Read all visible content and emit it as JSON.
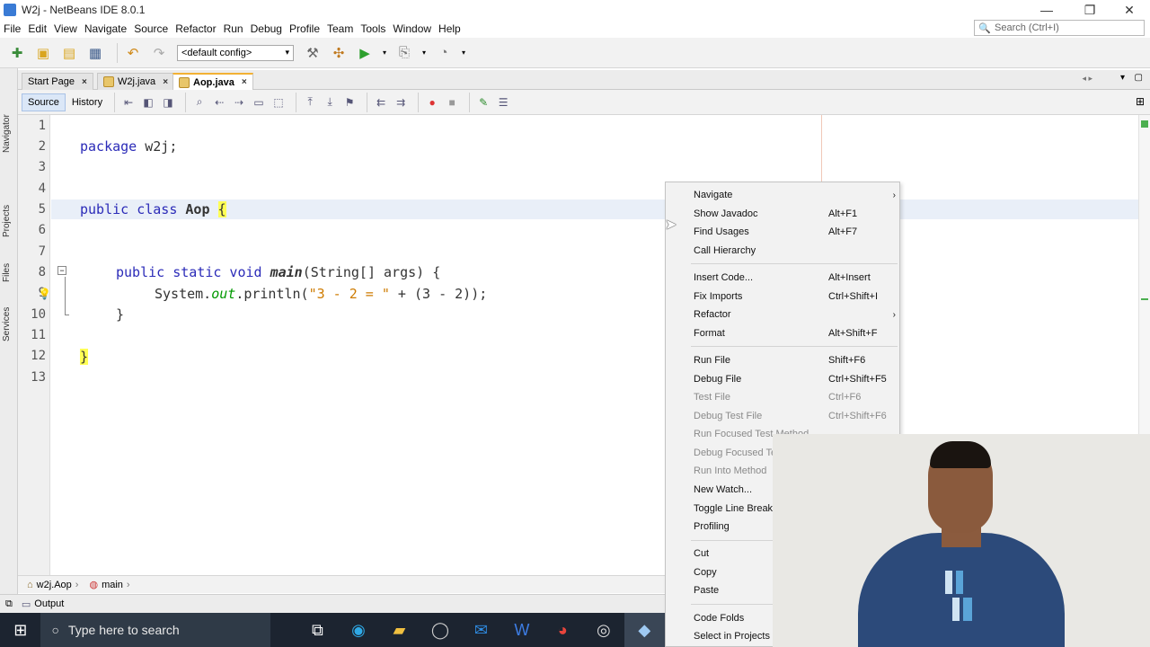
{
  "window": {
    "title": "W2j - NetBeans IDE 8.0.1",
    "minimize": "—",
    "maximize": "❐",
    "close": "✕"
  },
  "menubar": [
    "File",
    "Edit",
    "View",
    "Navigate",
    "Source",
    "Refactor",
    "Run",
    "Debug",
    "Profile",
    "Team",
    "Tools",
    "Window",
    "Help"
  ],
  "search": {
    "placeholder": "Search (Ctrl+I)"
  },
  "toolbar": {
    "config": "<default config>"
  },
  "side_panels": [
    "Navigator",
    "Projects",
    "Files",
    "Services"
  ],
  "tabs": [
    {
      "label": "Start Page",
      "active": false
    },
    {
      "label": "W2j.java",
      "active": false
    },
    {
      "label": "Aop.java",
      "active": true
    }
  ],
  "editor_tabs": {
    "source": "Source",
    "history": "History"
  },
  "code": {
    "line_numbers": [
      "1",
      "2",
      "3",
      "4",
      "5",
      "6",
      "7",
      "8",
      "9",
      "10",
      "11",
      "12",
      "13"
    ],
    "lines": {
      "l2_kw": "package",
      "l2_rest": " w2j;",
      "l5_kw": "public class",
      "l5_name": "Aop",
      "l5_brace": "{",
      "l8_kw": "public static void",
      "l8_method": "main",
      "l8_rest": "(String[] args) {",
      "l9_a": "System.",
      "l9_field": "out",
      "l9_b": ".println(",
      "l9_str": "\"3 - 2 = \"",
      "l9_c": " + (3 - 2));",
      "l10": "}",
      "l12": "}"
    }
  },
  "breadcrumb": [
    "w2j.Aop",
    "main"
  ],
  "output_label": "Output",
  "taskbar": {
    "search_placeholder": "Type here to search"
  },
  "context_menu": {
    "group1": [
      {
        "label": "Navigate",
        "shortcut": "",
        "submenu": true,
        "disabled": false
      },
      {
        "label": "Show Javadoc",
        "shortcut": "Alt+F1",
        "submenu": false,
        "disabled": false
      },
      {
        "label": "Find Usages",
        "shortcut": "Alt+F7",
        "submenu": false,
        "disabled": false
      },
      {
        "label": "Call Hierarchy",
        "shortcut": "",
        "submenu": false,
        "disabled": false
      }
    ],
    "group2": [
      {
        "label": "Insert Code...",
        "shortcut": "Alt+Insert",
        "submenu": false,
        "disabled": false
      },
      {
        "label": "Fix Imports",
        "shortcut": "Ctrl+Shift+I",
        "submenu": false,
        "disabled": false
      },
      {
        "label": "Refactor",
        "shortcut": "",
        "submenu": true,
        "disabled": false
      },
      {
        "label": "Format",
        "shortcut": "Alt+Shift+F",
        "submenu": false,
        "disabled": false
      }
    ],
    "group3": [
      {
        "label": "Run File",
        "shortcut": "Shift+F6",
        "submenu": false,
        "disabled": false
      },
      {
        "label": "Debug File",
        "shortcut": "Ctrl+Shift+F5",
        "submenu": false,
        "disabled": false
      },
      {
        "label": "Test File",
        "shortcut": "Ctrl+F6",
        "submenu": false,
        "disabled": true
      },
      {
        "label": "Debug Test File",
        "shortcut": "Ctrl+Shift+F6",
        "submenu": false,
        "disabled": true
      },
      {
        "label": "Run Focused Test Method",
        "shortcut": "",
        "submenu": false,
        "disabled": true
      },
      {
        "label": "Debug Focused Te",
        "shortcut": "",
        "submenu": false,
        "disabled": true
      },
      {
        "label": "Run Into Method",
        "shortcut": "",
        "submenu": false,
        "disabled": true
      },
      {
        "label": "New Watch...",
        "shortcut": "",
        "submenu": false,
        "disabled": false
      },
      {
        "label": "Toggle Line Breakp",
        "shortcut": "",
        "submenu": false,
        "disabled": false
      },
      {
        "label": "Profiling",
        "shortcut": "",
        "submenu": false,
        "disabled": false
      }
    ],
    "group4": [
      {
        "label": "Cut",
        "shortcut": "",
        "submenu": false,
        "disabled": false
      },
      {
        "label": "Copy",
        "shortcut": "",
        "submenu": false,
        "disabled": false
      },
      {
        "label": "Paste",
        "shortcut": "",
        "submenu": false,
        "disabled": false
      }
    ],
    "group5": [
      {
        "label": "Code Folds",
        "shortcut": "",
        "submenu": false,
        "disabled": false
      },
      {
        "label": "Select in Projects",
        "shortcut": "",
        "submenu": false,
        "disabled": false
      }
    ]
  },
  "colors": {
    "keyword": "#2b2bb8",
    "string": "#ce7b00",
    "field": "#009900",
    "brace_highlight": "#ffff55",
    "current_line": "#e9eff8"
  }
}
